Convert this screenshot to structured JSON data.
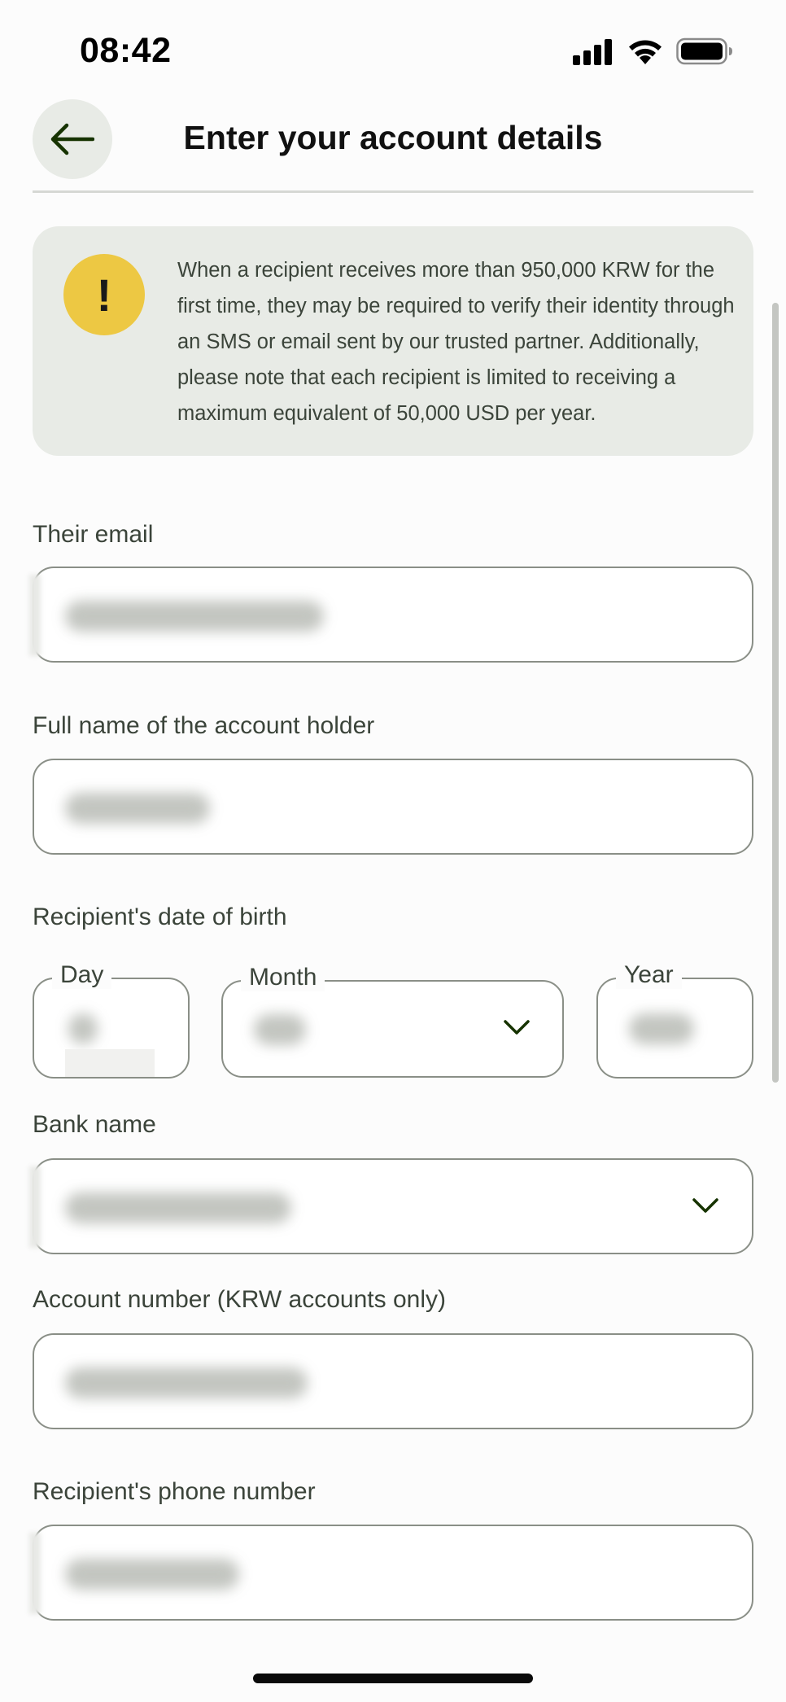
{
  "status_bar": {
    "time": "08:42"
  },
  "header": {
    "title": "Enter your account details"
  },
  "warning": {
    "icon": "!",
    "text": "When a recipient receives more than 950,000 KRW for the first time, they may be required to verify their identity through an SMS or email sent by our trusted partner. Additionally, please note that each recipient is limited to receiving a maximum equivalent of 50,000 USD per year."
  },
  "form": {
    "email_label": "Their email",
    "full_name_label": "Full name of the account holder",
    "dob_label": "Recipient's date of birth",
    "dob": {
      "day_label": "Day",
      "month_label": "Month",
      "year_label": "Year"
    },
    "bank_label": "Bank name",
    "account_label": "Account number (KRW accounts only)",
    "phone_label": "Recipient's phone number"
  },
  "colors": {
    "accent_dark_green": "#163300",
    "warning_yellow": "#edc843",
    "banner_bg": "#e8ebe6",
    "field_border": "#8a8f87"
  },
  "icons": {
    "back": "arrow-left-icon",
    "warning": "exclamation-icon",
    "dropdown": "chevron-down-icon",
    "signal": "cellular-signal-icon",
    "wifi": "wifi-icon",
    "battery": "battery-icon"
  }
}
